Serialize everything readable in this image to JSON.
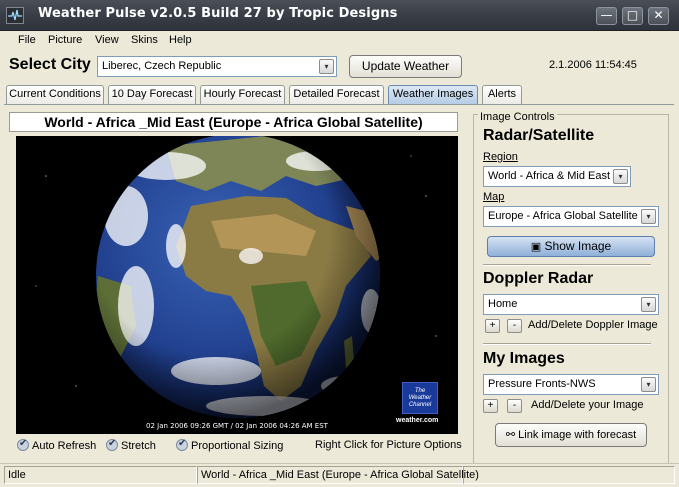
{
  "window": {
    "title": "Weather Pulse v2.0.5 Build 27 by Tropic Designs",
    "minimize": "0",
    "maximize": "1",
    "close": "r"
  },
  "menu": [
    "File",
    "Picture",
    "View",
    "Skins",
    "Help"
  ],
  "city": {
    "label": "Select City",
    "value": "Liberec, Czech Republic",
    "update_button": "Update Weather",
    "datetime": "2.1.2006 11:54:45"
  },
  "tabs": [
    "Current Conditions",
    "10 Day Forecast",
    "Hourly Forecast",
    "Detailed Forecast",
    "Weather Images",
    "Alerts"
  ],
  "active_tab": "Weather Images",
  "image": {
    "title": "World - Africa _Mid East (Europe - Africa Global Satellite)",
    "caption": "02 Jan 2006 09:26 GMT / 02 Jan 2006 04:26 AM EST",
    "logo_text": "The Weather Channel",
    "source_text": "weather.com"
  },
  "options": {
    "auto_refresh": "Auto Refresh",
    "stretch": "Stretch",
    "proportional": "Proportional Sizing",
    "hint": "Right Click for Picture Options"
  },
  "side": {
    "legend": "Image Controls",
    "radar_title": "Radar/Satellite",
    "region_label": "Region",
    "region_value": "World - Africa & Mid East",
    "map_label": "Map",
    "map_value": "Europe - Africa Global Satellite",
    "show_image": "Show Image",
    "doppler_title": "Doppler Radar",
    "doppler_value": "Home",
    "doppler_add_delete": "Add/Delete Doppler Image",
    "my_images_title": "My Images",
    "my_images_value": "Pressure Fronts-NWS",
    "my_images_add_delete": "Add/Delete your Image",
    "link_button": "Link image with forecast"
  },
  "status": {
    "left": "Idle",
    "center": "World - Africa _Mid East (Europe - Africa Global Satellite)"
  },
  "colors": {
    "titlebar": "#3a3f48",
    "active_tab": "#b6cde6",
    "ocean": "#1f3f8f",
    "land": "#6b7a3a",
    "logo": "#1a3a9a"
  }
}
